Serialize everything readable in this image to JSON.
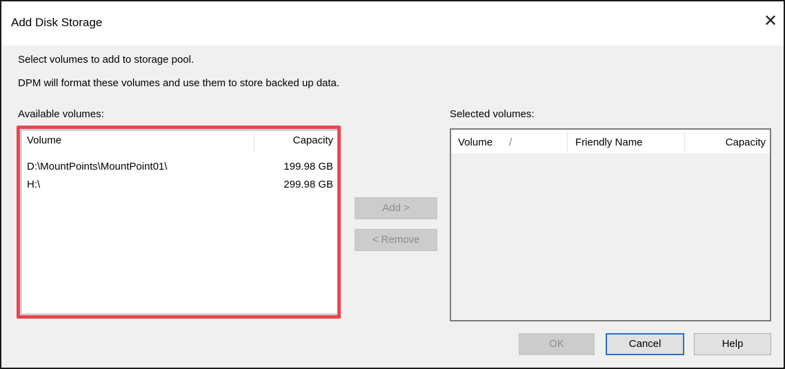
{
  "dialog": {
    "title": "Add Disk Storage",
    "close_glyph": "✕"
  },
  "instructions": {
    "line1": "Select volumes to add to storage pool.",
    "line2": "DPM will format these volumes and use them to store backed up data."
  },
  "available": {
    "label": "Available volumes:",
    "columns": {
      "volume": "Volume",
      "capacity": "Capacity"
    },
    "rows": [
      {
        "volume": "D:\\MountPoints\\MountPoint01\\",
        "capacity": "199.98 GB"
      },
      {
        "volume": "H:\\",
        "capacity": "299.98 GB"
      }
    ]
  },
  "selected": {
    "label": "Selected volumes:",
    "columns": {
      "volume": "Volume",
      "sort_indicator": "/",
      "friendly_name": "Friendly Name",
      "capacity": "Capacity"
    }
  },
  "buttons": {
    "add": "Add >",
    "remove": "< Remove",
    "ok": "OK",
    "cancel": "Cancel",
    "help": "Help"
  },
  "colors": {
    "highlight": "#e8474f",
    "primary_border": "#2a6fc9"
  }
}
